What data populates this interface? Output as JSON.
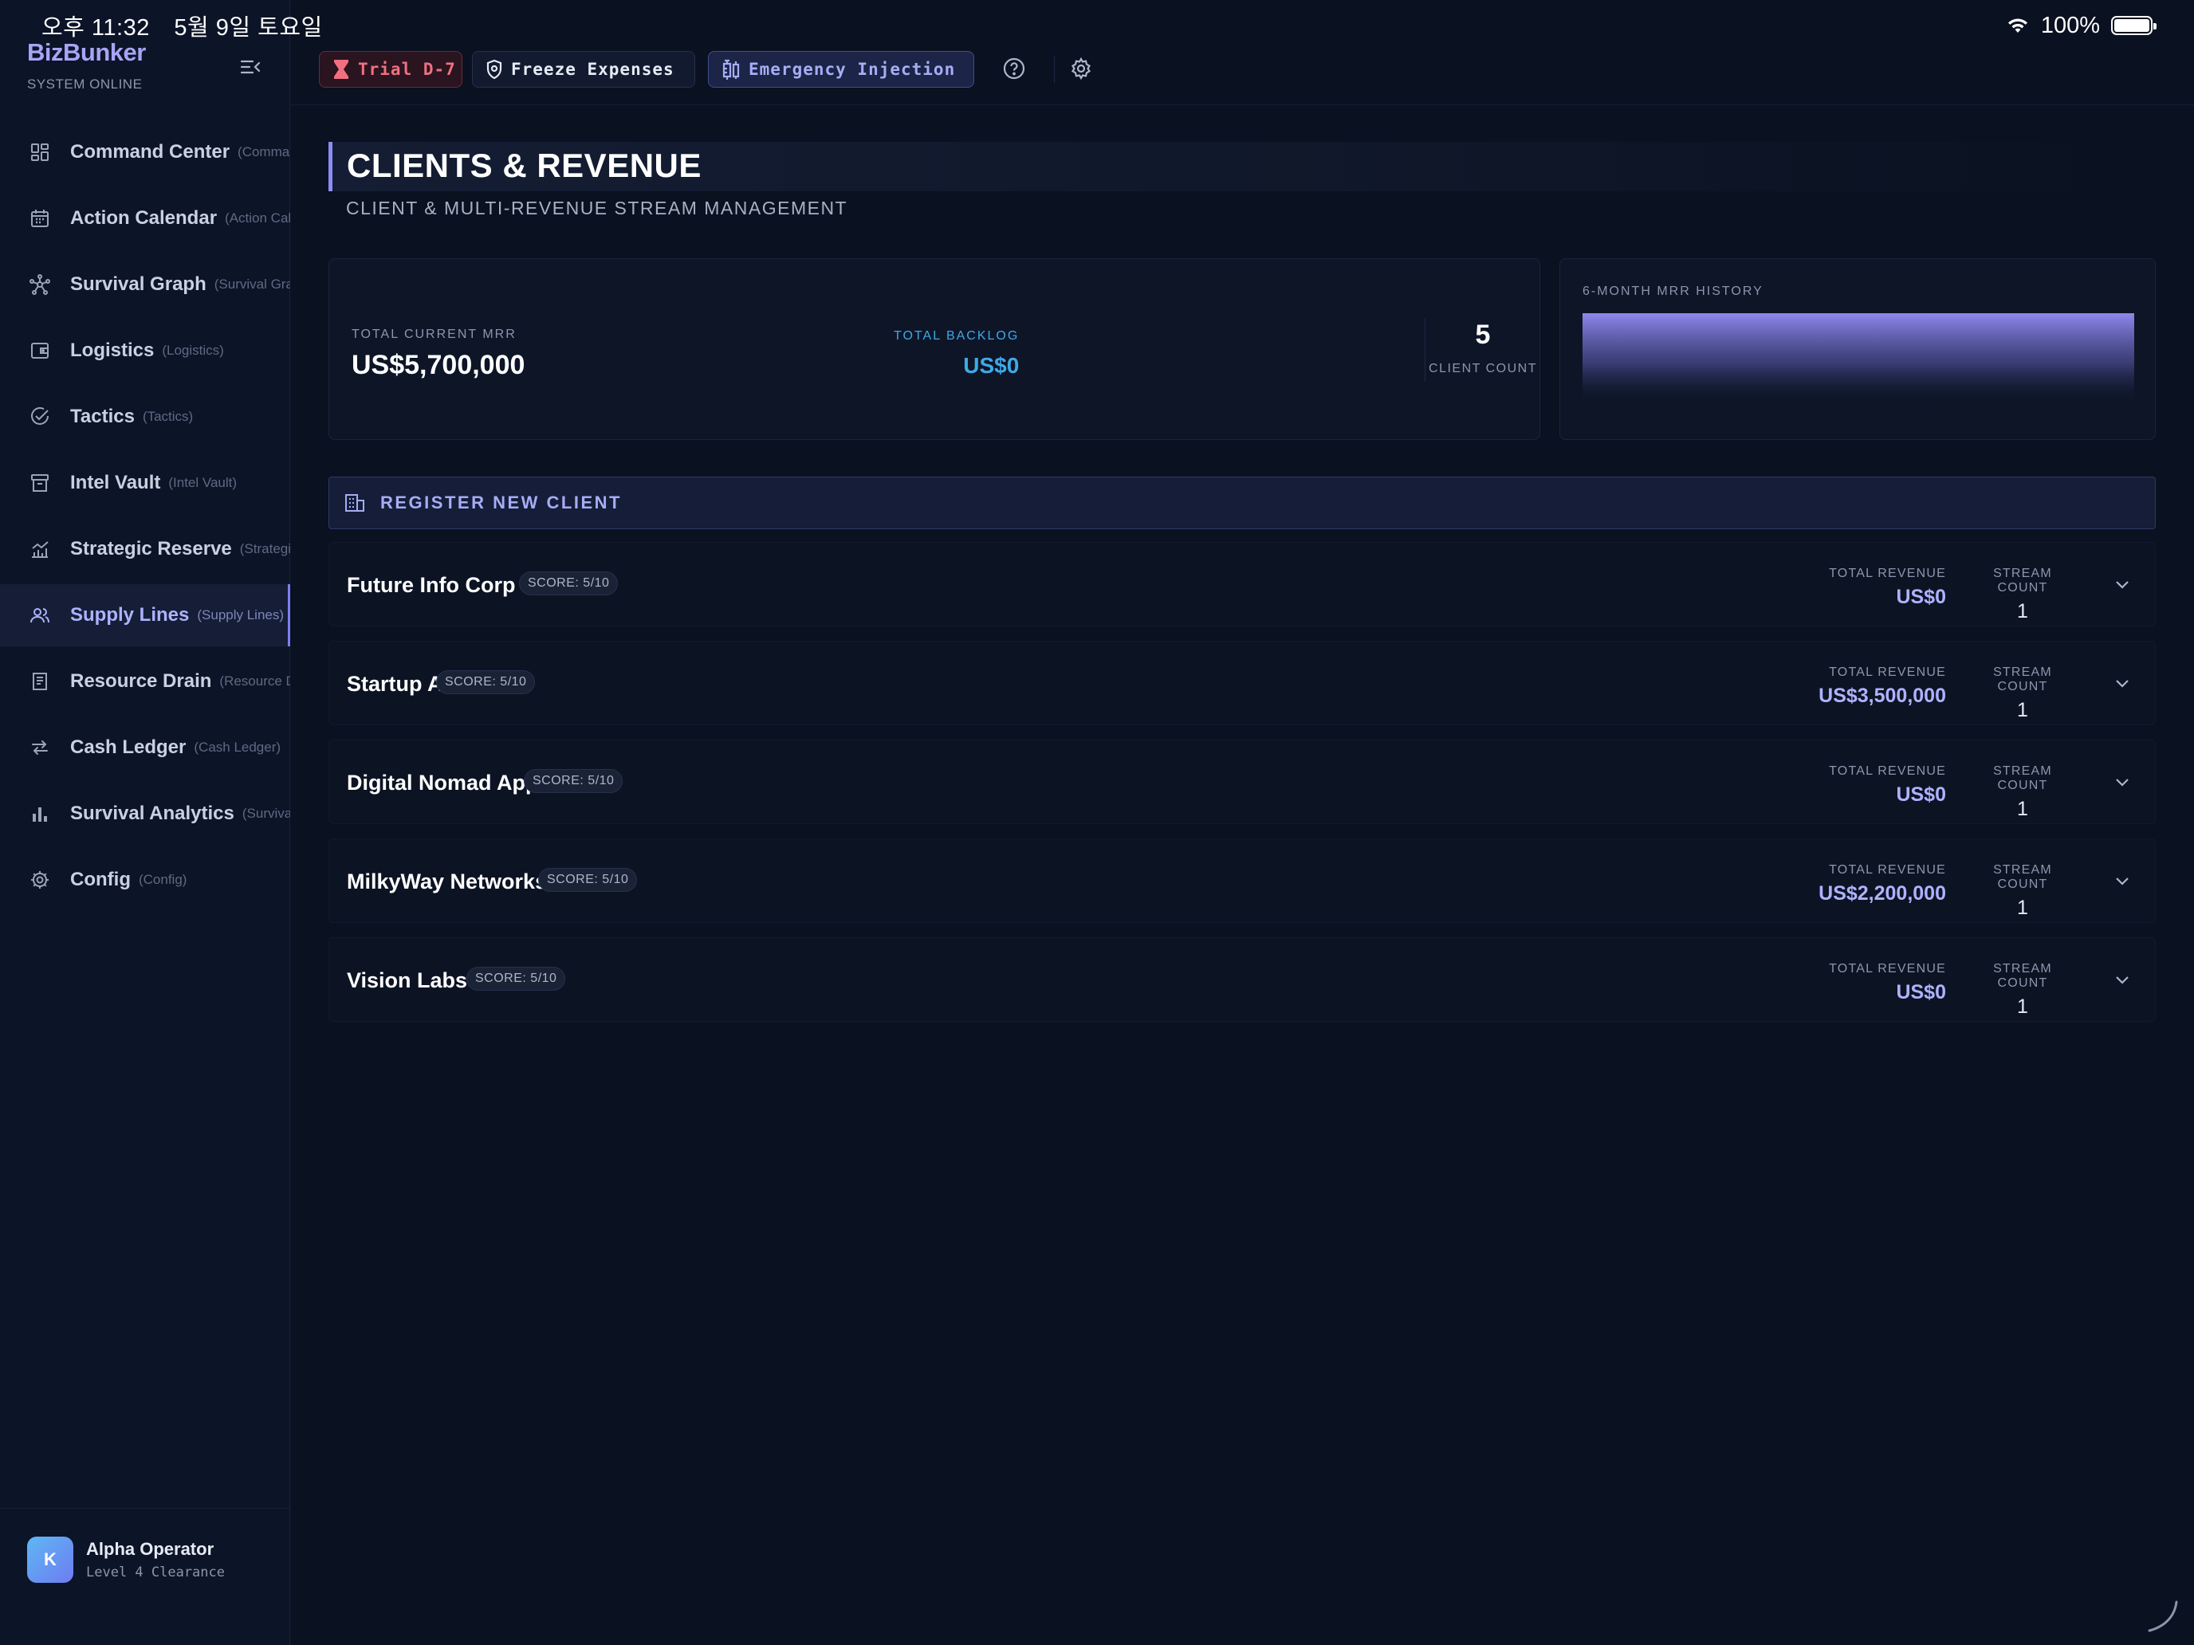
{
  "status_bar": {
    "time": "오후 11:32",
    "date": "5월 9일 토요일",
    "battery": "100%"
  },
  "sidebar": {
    "brand": "BizBunker",
    "status": "SYSTEM ONLINE",
    "items": [
      {
        "label": "Command Center",
        "sub": "(Command Center)",
        "icon": "dashboard-icon"
      },
      {
        "label": "Action Calendar",
        "sub": "(Action Calendar)",
        "icon": "calendar-icon"
      },
      {
        "label": "Survival Graph",
        "sub": "(Survival Graph)",
        "icon": "graph-nodes-icon"
      },
      {
        "label": "Logistics",
        "sub": "(Logistics)",
        "icon": "wallet-icon"
      },
      {
        "label": "Tactics",
        "sub": "(Tactics)",
        "icon": "check-circle-icon"
      },
      {
        "label": "Intel Vault",
        "sub": "(Intel Vault)",
        "icon": "archive-icon"
      },
      {
        "label": "Strategic Reserve",
        "sub": "(Strategic Reserve)",
        "icon": "chart-icon"
      },
      {
        "label": "Supply Lines",
        "sub": "(Supply Lines)",
        "icon": "users-icon",
        "active": true
      },
      {
        "label": "Resource Drain",
        "sub": "(Resource Drain)",
        "icon": "receipt-icon"
      },
      {
        "label": "Cash Ledger",
        "sub": "(Cash Ledger)",
        "icon": "swap-icon"
      },
      {
        "label": "Survival Analytics",
        "sub": "(Survival Analytics)",
        "icon": "bar-chart-icon"
      },
      {
        "label": "Config",
        "sub": "(Config)",
        "icon": "gear-icon"
      }
    ],
    "user": {
      "initial": "K",
      "name": "Alpha Operator",
      "level": "Level 4 Clearance"
    }
  },
  "toolbar": {
    "trial": "Trial D-7",
    "freeze": "Freeze Expenses",
    "emergency": "Emergency Injection"
  },
  "page": {
    "title": "CLIENTS & REVENUE",
    "subtitle": "CLIENT & MULTI-REVENUE STREAM MANAGEMENT"
  },
  "stats": {
    "mrr_label": "TOTAL CURRENT MRR",
    "mrr_value": "US$5,700,000",
    "backlog_label": "TOTAL BACKLOG",
    "backlog_value": "US$0",
    "count_value": "5",
    "count_label": "CLIENT COUNT"
  },
  "history": {
    "label": "6-MONTH MRR HISTORY"
  },
  "register_label": "REGISTER NEW CLIENT",
  "client_labels": {
    "revenue": "TOTAL REVENUE",
    "streams": "STREAM COUNT"
  },
  "clients": [
    {
      "name": "Future Info Corp",
      "score": "SCORE: 5/10",
      "revenue": "US$0",
      "streams": "1"
    },
    {
      "name": "Startup A",
      "score": "SCORE: 5/10",
      "revenue": "US$3,500,000",
      "streams": "1"
    },
    {
      "name": "Digital Nomad App",
      "score": "SCORE: 5/10",
      "revenue": "US$0",
      "streams": "1"
    },
    {
      "name": "MilkyWay Networks",
      "score": "SCORE: 5/10",
      "revenue": "US$2,200,000",
      "streams": "1"
    },
    {
      "name": "Vision Labs",
      "score": "SCORE: 5/10",
      "revenue": "US$0",
      "streams": "1"
    }
  ],
  "colors": {
    "accent": "#8e8cf2",
    "backlog": "#3fa9e8",
    "danger": "#f07080",
    "background": "#0a1120"
  }
}
